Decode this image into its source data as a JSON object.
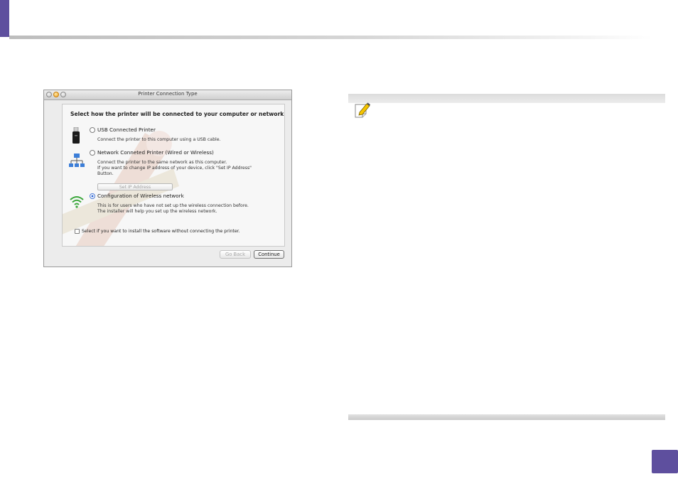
{
  "window": {
    "title": "Printer Connection Type",
    "heading": "Select how the printer will be connected to your computer or network.",
    "options": [
      {
        "label": "USB Connected Printer",
        "description": [
          "Connect the printer to this computer using a USB cable."
        ],
        "selected": false,
        "icon": "usb-icon"
      },
      {
        "label": "Network Conneted Printer (Wired or Wireless)",
        "description": [
          "Connect the printer to the same network as this computer.",
          "If you want to change IP address of your device, click \"Set IP Address\"",
          "Button."
        ],
        "selected": false,
        "icon": "network-icon"
      },
      {
        "label": "Configuration of Wireless network",
        "description": [
          "This is for users who have not set up the wireless connection before.",
          "The installer will help you set up the wireless network."
        ],
        "selected": true,
        "icon": "wifi-icon"
      }
    ],
    "set_ip_button": "Set IP Address",
    "checkbox_label": "Select if you want to install the software without connecting the printer.",
    "checkbox_checked": false,
    "go_back_button": "Go Back",
    "continue_button": "Continue"
  },
  "colors": {
    "brand_purple": "#5e4f9e",
    "selected_radio": "#2a63d4",
    "note_icon": "#f5c400"
  },
  "icons": {
    "note": "note-pencil-icon"
  }
}
